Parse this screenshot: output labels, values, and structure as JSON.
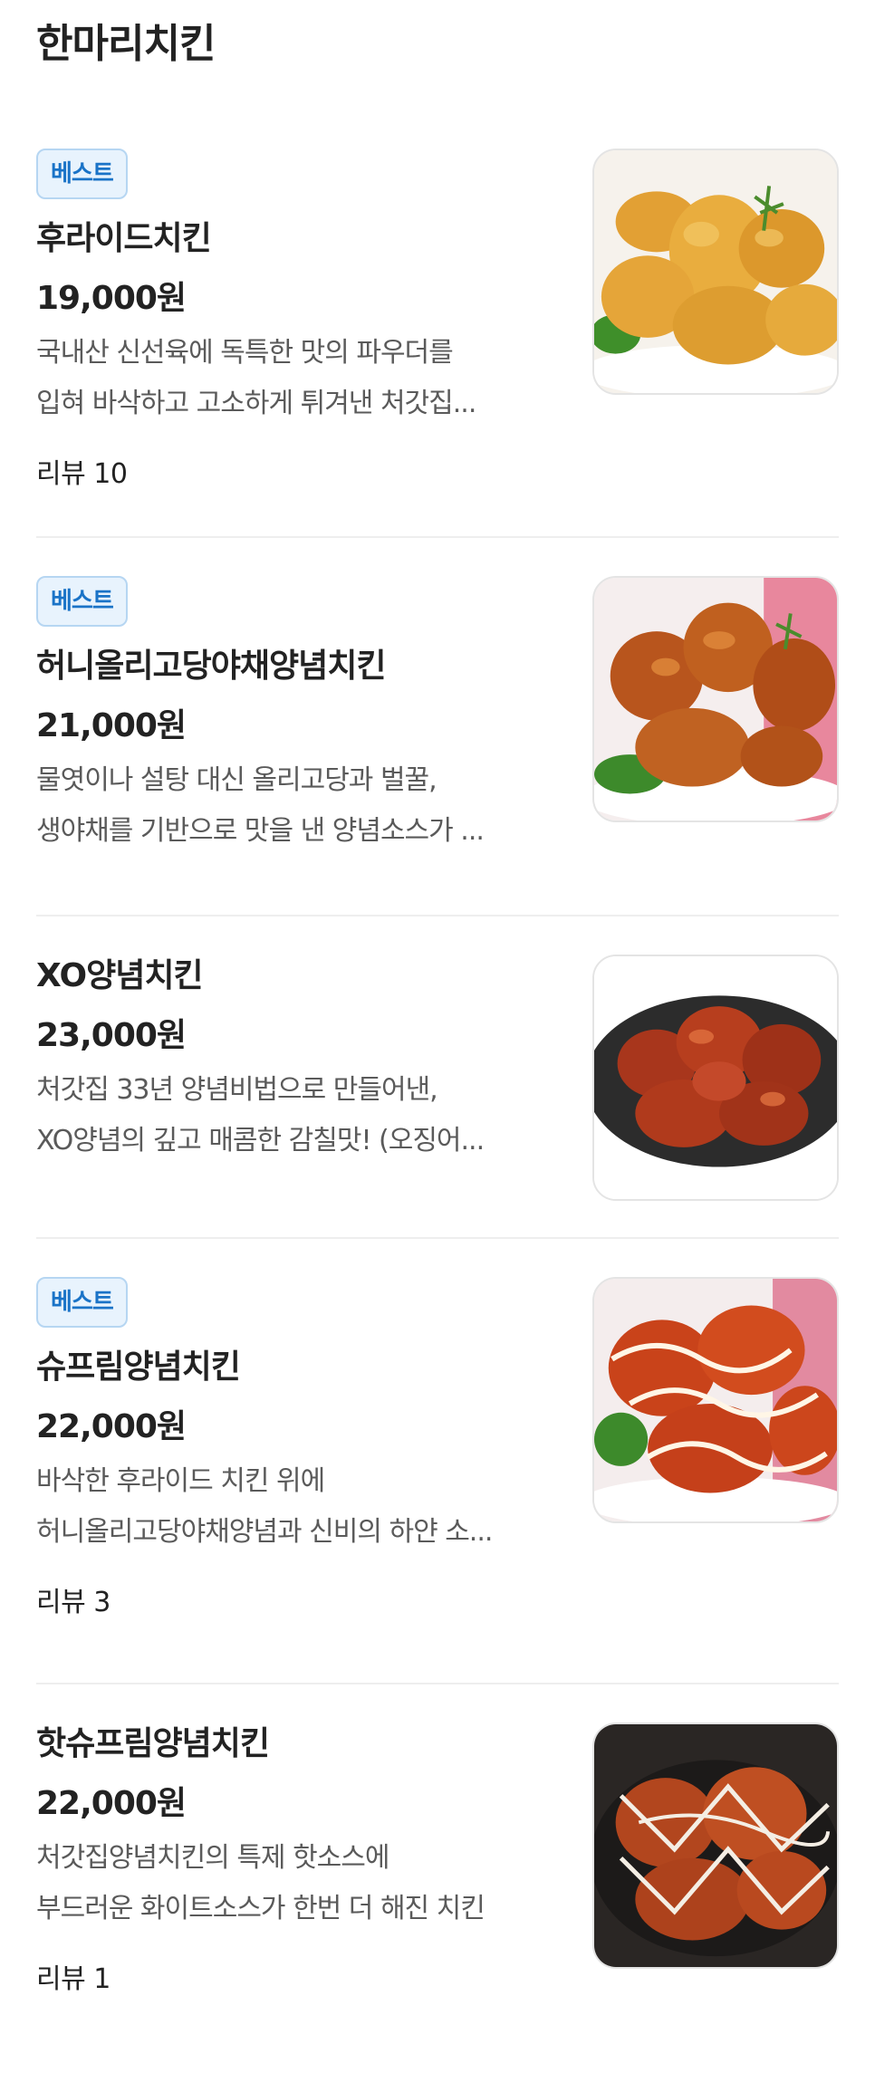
{
  "section": {
    "title": "한마리치킨"
  },
  "items": [
    {
      "badge": "베스트",
      "name": "후라이드치킨",
      "price": "19,000원",
      "desc_line1": "국내산 신선육에 독특한 맛의 파우더를",
      "desc_line2": "입혀 바삭하고 고소하게 튀겨낸 처갓집...",
      "review": "리뷰 10",
      "photo": "fried-chicken-photo"
    },
    {
      "badge": "베스트",
      "name": "허니올리고당야채양념치킨",
      "price": "21,000원",
      "desc_line1": "물엿이나 설탕 대신 올리고당과 벌꿀,",
      "desc_line2": "생야채를 기반으로 맛을 낸 양념소스가 ...",
      "review": "",
      "photo": "honey-sauce-chicken-photo"
    },
    {
      "badge": "",
      "name": "XO양념치킨",
      "price": "23,000원",
      "desc_line1": "처갓집 33년 양념비법으로 만들어낸,",
      "desc_line2": "XO양념의 깊고 매콤한 감칠맛! (오징어...",
      "review": "",
      "photo": "xo-sauce-chicken-photo"
    },
    {
      "badge": "베스트",
      "name": "슈프림양념치킨",
      "price": "22,000원",
      "desc_line1": "바삭한 후라이드 치킨 위에",
      "desc_line2": "허니올리고당야채양념과 신비의 하얀 소...",
      "review": "리뷰 3",
      "photo": "supreme-chicken-photo"
    },
    {
      "badge": "",
      "name": "핫슈프림양념치킨",
      "price": "22,000원",
      "desc_line1": "처갓집양념치킨의 특제 핫소스에",
      "desc_line2": "부드러운 화이트소스가 한번 더 해진 치킨",
      "review": "리뷰 1",
      "photo": "hot-supreme-chicken-photo"
    }
  ]
}
